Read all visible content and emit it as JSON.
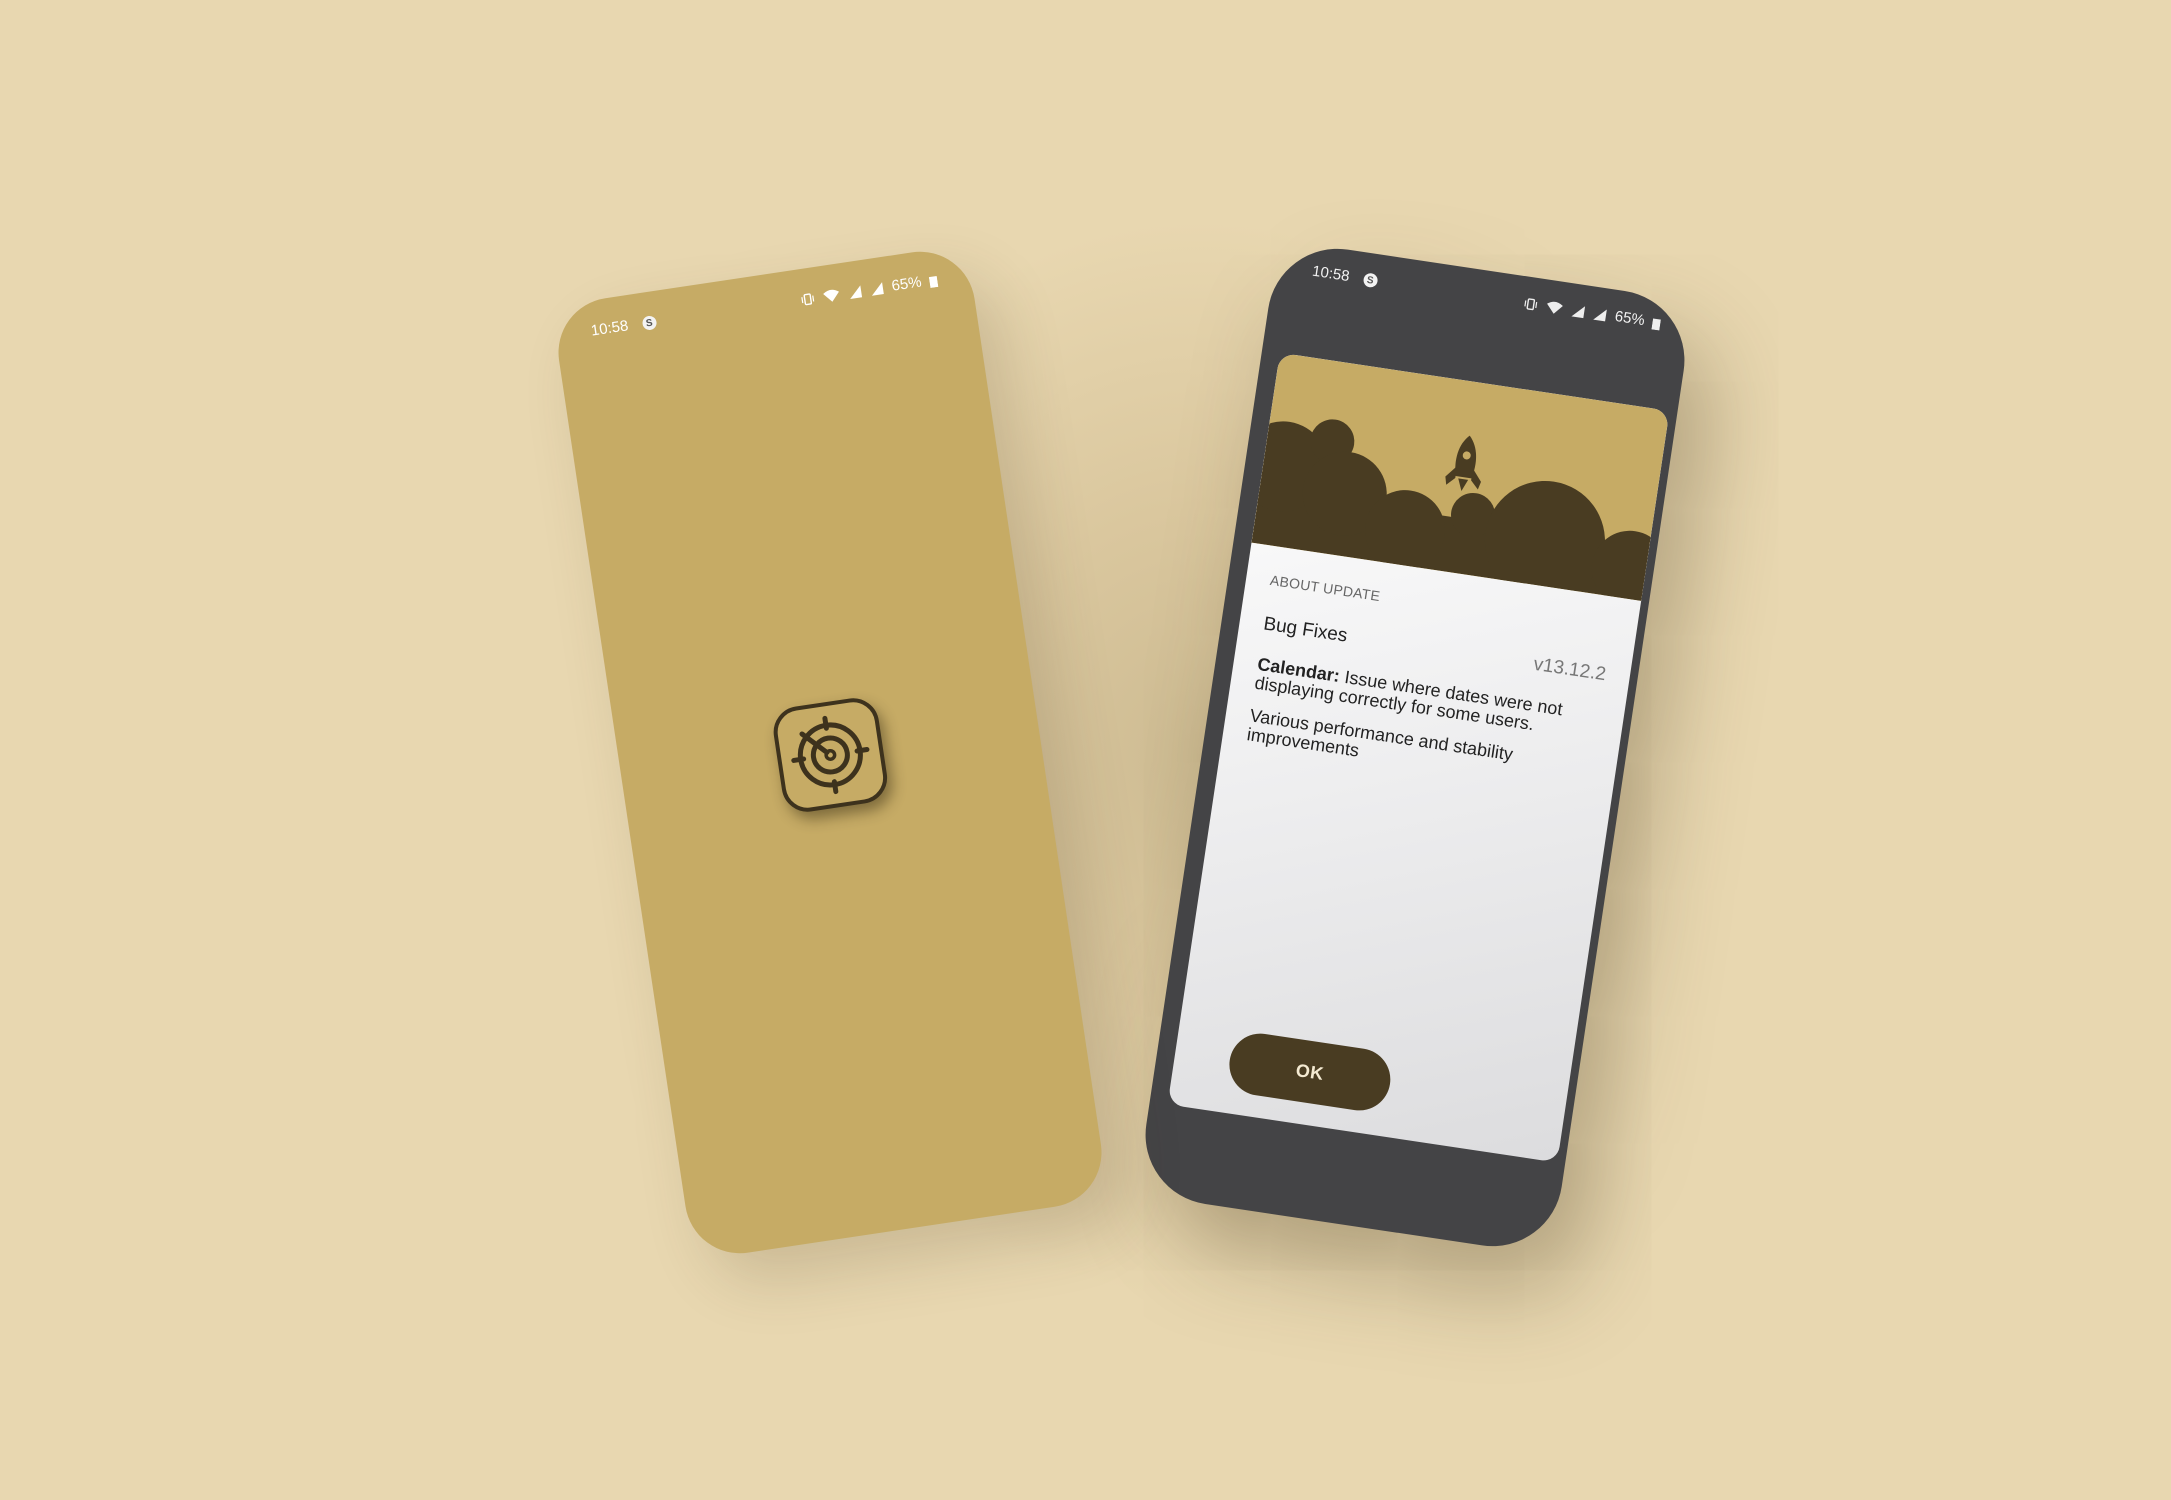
{
  "status_bar": {
    "time": "10:58",
    "notification_icon": "sync-badge-icon",
    "battery_percent": "65%",
    "icons": [
      "vibrate-icon",
      "wifi-icon",
      "signal-icon",
      "signal-icon",
      "battery-icon"
    ]
  },
  "splash": {
    "app_icon": "target-crosshair-icon",
    "background_color": "#c6ab65"
  },
  "dialog": {
    "header_icon": "rocket-icon",
    "section_label": "ABOUT UPDATE",
    "title": "Bug Fixes",
    "version": "v13.12.2",
    "notes": [
      {
        "label": "Calendar:",
        "text": " Issue where dates were not displaying correctly for some users."
      },
      {
        "label": "",
        "text": "Various performance and stability improvements"
      }
    ],
    "ok_label": "OK"
  },
  "colors": {
    "page_background": "#e8d7b0",
    "gold": "#c6ab65",
    "dark_brown": "#493c22",
    "phone_dark": "#444446"
  }
}
